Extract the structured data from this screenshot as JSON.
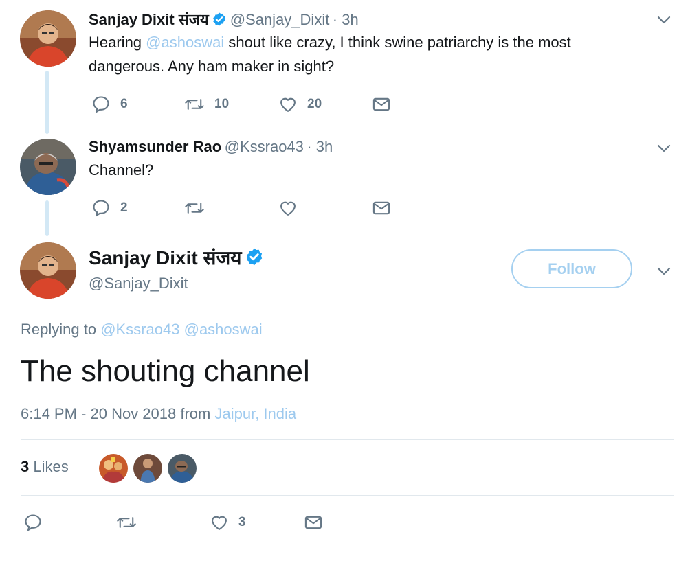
{
  "thread": [
    {
      "name": "Sanjay Dixit संजय",
      "handle": "@Sanjay_Dixit",
      "time": "· 3h",
      "text_pre": "Hearing ",
      "mention": "@ashoswai",
      "text_post": " shout like crazy, I think swine patriarchy is the most dangerous. Any ham maker in sight?",
      "replies": "6",
      "retweets": "10",
      "likes": "20"
    },
    {
      "name": "Shyamsunder Rao",
      "handle": "@Kssrao43",
      "time": "· 3h",
      "text": "Channel?",
      "replies": "2",
      "retweets": "",
      "likes": ""
    }
  ],
  "main_tweet": {
    "name": "Sanjay Dixit संजय",
    "handle": "@Sanjay_Dixit",
    "follow_label": "Follow",
    "replying_label": "Replying to",
    "replying_mention_1": "@Kssrao43",
    "replying_mention_2": "@ashoswai",
    "text": "The shouting channel",
    "timestamp": "6:14 PM - 20 Nov 2018 from",
    "location": "Jaipur, India",
    "likes_count": "3",
    "likes_label": "Likes",
    "action_likes": "3"
  },
  "colors": {
    "link": "#9dc9ee",
    "muted": "#657786",
    "verified": "#1da1f2",
    "thread_line": "#d3e8f5"
  },
  "icons": [
    "reply-icon",
    "retweet-icon",
    "heart-icon",
    "envelope-icon",
    "chevron-down-icon",
    "verified-badge-icon"
  ]
}
